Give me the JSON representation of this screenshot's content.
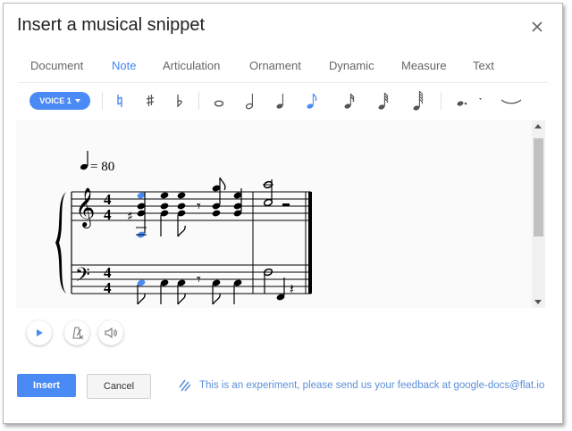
{
  "dialog": {
    "title": "Insert a musical snippet",
    "close_icon": "close-icon"
  },
  "tabs": [
    {
      "label": "Document",
      "active": false
    },
    {
      "label": "Note",
      "active": true
    },
    {
      "label": "Articulation",
      "active": false
    },
    {
      "label": "Ornament",
      "active": false
    },
    {
      "label": "Dynamic",
      "active": false
    },
    {
      "label": "Measure",
      "active": false
    },
    {
      "label": "Text",
      "active": false
    }
  ],
  "toolbar": {
    "voice_label": "VOICE 1",
    "tools": [
      "natural-icon",
      "sharp-icon",
      "flat-icon",
      "whole-note-icon",
      "half-note-icon",
      "quarter-note-icon",
      "eighth-note-icon",
      "sixteenth-note-icon",
      "thirty-second-note-icon",
      "sixty-fourth-note-icon",
      "dotted-note-icon",
      "tie-icon"
    ]
  },
  "score": {
    "tempo_value": "= 80",
    "time_signature": "4/4"
  },
  "controls": {
    "play_icon": "play-icon",
    "metronome_icon": "metronome-icon",
    "volume_icon": "volume-icon"
  },
  "footer": {
    "insert_label": "Insert",
    "cancel_label": "Cancel",
    "feedback_text": "This is an experiment, please send us your feedback at google-docs@flat.io"
  },
  "colors": {
    "accent": "#4a8af4",
    "selected_note": "#4a8af4"
  }
}
